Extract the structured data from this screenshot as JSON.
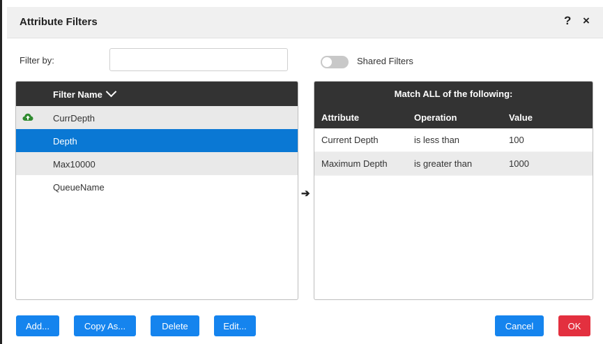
{
  "dialog": {
    "title": "Attribute Filters",
    "help_label": "?",
    "close_label": "×"
  },
  "filter": {
    "label": "Filter by:",
    "value": "",
    "placeholder": ""
  },
  "shared_filters": {
    "label": "Shared Filters",
    "enabled": false
  },
  "filter_list": {
    "header": "Filter Name",
    "items": [
      {
        "name": "CurrDepth",
        "icon": "cloud-upload-icon",
        "state": "alternate"
      },
      {
        "name": "Depth",
        "icon": "",
        "state": "selected"
      },
      {
        "name": "Max10000",
        "icon": "",
        "state": "alternate"
      },
      {
        "name": "QueueName",
        "icon": "",
        "state": "normal"
      }
    ]
  },
  "transfer_arrow": "➔",
  "conditions": {
    "title": "Match ALL of the following:",
    "columns": [
      "Attribute",
      "Operation",
      "Value"
    ],
    "rows": [
      {
        "attribute": "Current Depth",
        "operation": "is less than",
        "value": "100"
      },
      {
        "attribute": "Maximum Depth",
        "operation": "is greater than",
        "value": "1000"
      }
    ]
  },
  "buttons": {
    "add": "Add...",
    "copy_as": "Copy As...",
    "delete": "Delete",
    "edit": "Edit...",
    "cancel": "Cancel",
    "ok": "OK"
  },
  "colors": {
    "primary": "#1584ee",
    "danger": "#e3303f",
    "selected_row": "#0a78d4",
    "panel_header": "#333333",
    "cloud_icon": "#2f8a2f"
  }
}
